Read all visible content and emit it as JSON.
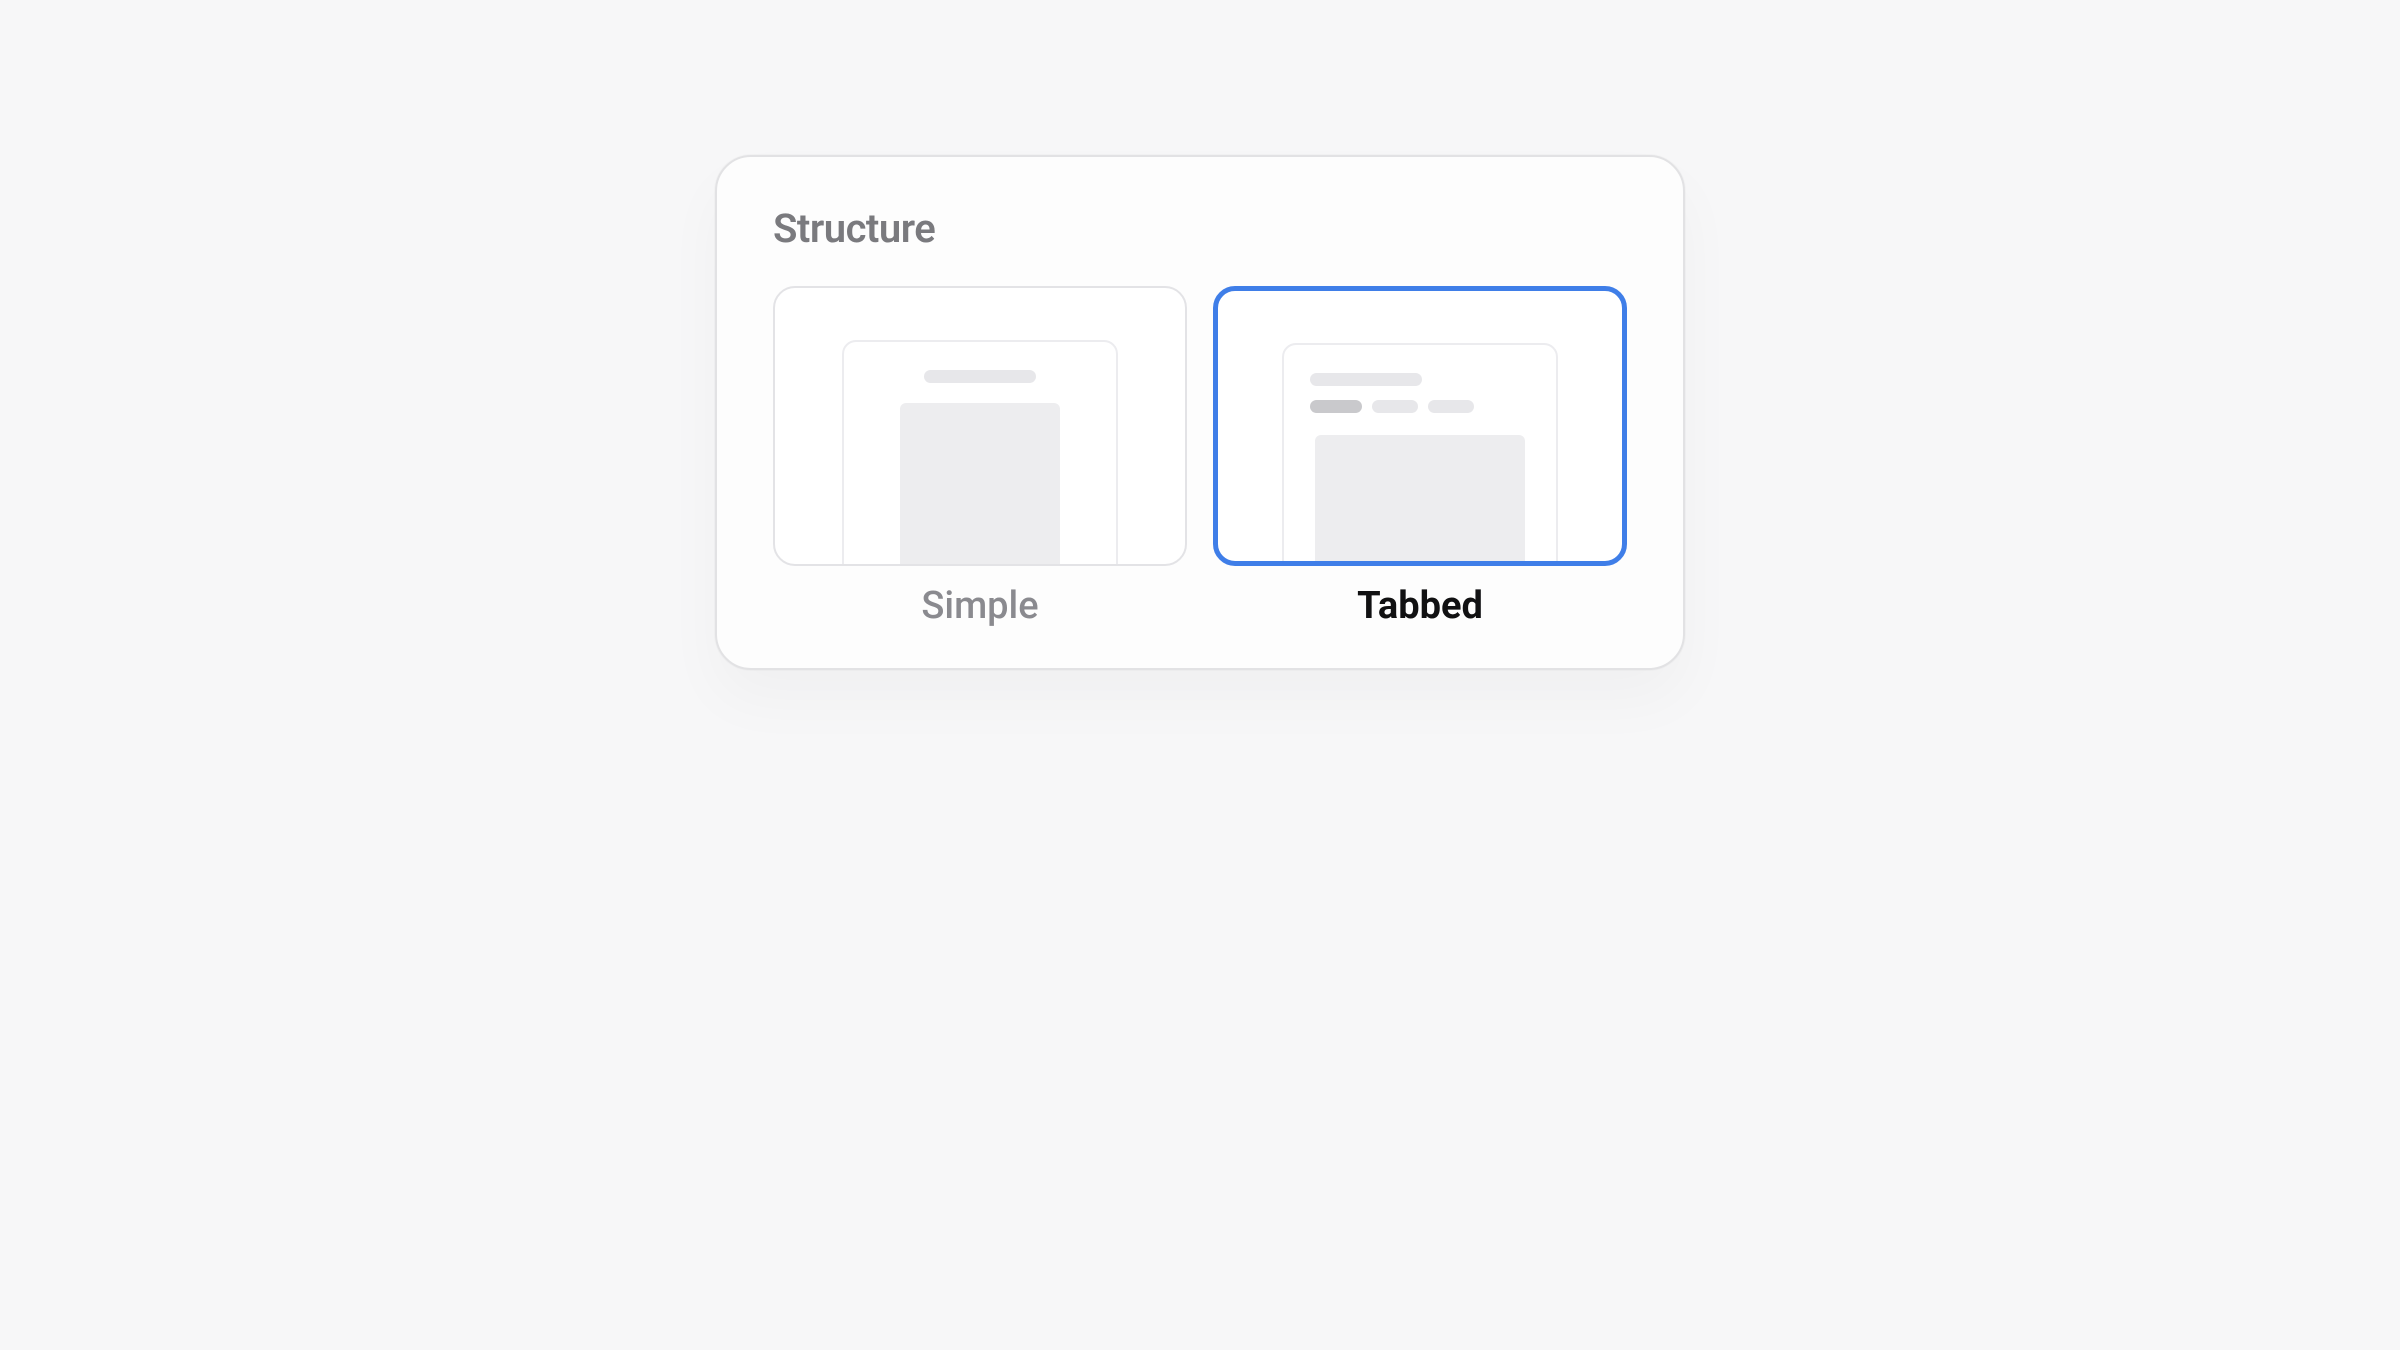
{
  "structure_picker": {
    "title": "Structure",
    "options": [
      {
        "id": "simple",
        "label": "Simple",
        "selected": false
      },
      {
        "id": "tabbed",
        "label": "Tabbed",
        "selected": true
      }
    ]
  },
  "colors": {
    "selection_border": "#3f7ee8",
    "panel_border": "#e2e2e4",
    "background": "#f7f7f8"
  }
}
